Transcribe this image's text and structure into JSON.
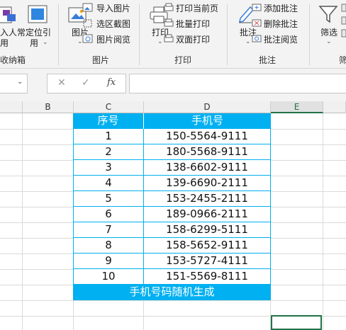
{
  "ribbon": {
    "partial_btn_label_1": "入人常",
    "partial_btn_label_2": "用",
    "locate_btn_label_1": "定位引",
    "locate_btn_label_2": "用",
    "group1_label": "收纳箱",
    "picture_btn_label": "图片",
    "import_picture": "导入图片",
    "region_screenshot": "选区截图",
    "picture_view": "图片阅览",
    "group_picture": "图片",
    "print_btn_label": "打印",
    "print_current": "打印当前页",
    "batch_print": "批量打印",
    "duplex_print": "双面打印",
    "group_print": "打印",
    "comment_btn_label": "批注",
    "add_comment": "添加批注",
    "delete_comment": "删除批注",
    "view_comment": "批注阅览",
    "group_comment": "批注",
    "filter_btn_label": "筛选",
    "group_partial": "筛"
  },
  "formula_bar": {
    "cancel_glyph": "✕",
    "confirm_glyph": "✓",
    "fx_label": "fx"
  },
  "grid": {
    "columns": [
      "B",
      "C",
      "D",
      "E"
    ],
    "selected_column": "E"
  },
  "table": {
    "header": [
      "序号",
      "手机号"
    ],
    "rows": [
      [
        "1",
        "150-5564-9111"
      ],
      [
        "2",
        "180-5568-9111"
      ],
      [
        "3",
        "138-6602-9111"
      ],
      [
        "4",
        "139-6690-2111"
      ],
      [
        "5",
        "153-2455-2111"
      ],
      [
        "6",
        "189-0966-2111"
      ],
      [
        "7",
        "158-6299-5111"
      ],
      [
        "8",
        "158-5652-9111"
      ],
      [
        "9",
        "153-5727-4111"
      ],
      [
        "10",
        "151-5569-8111"
      ]
    ],
    "footer": "手机号码随机生成"
  },
  "colors": {
    "table_accent": "#00b0f0",
    "selection": "#217346"
  }
}
